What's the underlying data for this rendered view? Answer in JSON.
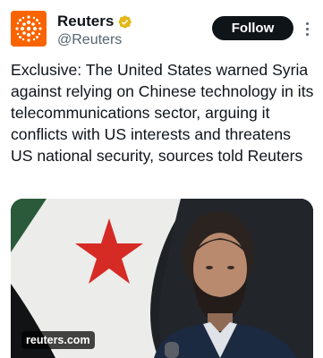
{
  "account": {
    "display_name": "Reuters",
    "handle": "@Reuters",
    "avatar_icon": "reuters-logo-icon",
    "verified_icon": "verified-badge-icon",
    "brand_color": "#fa6400",
    "verified_color": "#e2b719"
  },
  "actions": {
    "follow_label": "Follow",
    "more_icon": "more-options-icon"
  },
  "tweet": {
    "text": "Exclusive: The United States warned Syria against relying on Chinese technology in its telecommunications sector, arguing it conflicts with US interests and threatens US national security, sources told Reuters"
  },
  "media": {
    "link_label": "reuters.com"
  }
}
